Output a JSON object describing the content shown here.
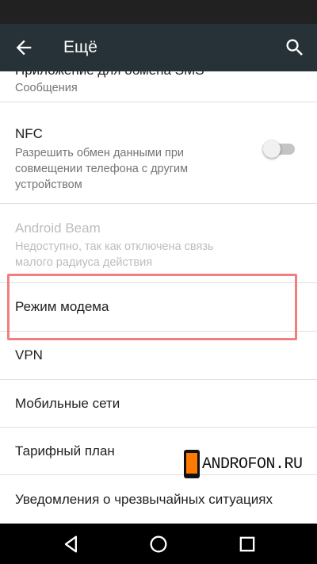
{
  "app_bar": {
    "title": "Ещё",
    "back_icon": "arrow-left-icon",
    "search_icon": "search-icon"
  },
  "items": [
    {
      "title": "Приложение для обмена SMS",
      "summary": "Сообщения"
    },
    {
      "title": "NFC",
      "summary": "Разрешить обмен данными при совмещении телефона с другим устройством",
      "toggle": "off"
    },
    {
      "title": "Android Beam",
      "summary": "Недоступно, так как отключена связь малого радиуса действия",
      "enabled": false
    },
    {
      "title": "Режим модема"
    },
    {
      "title": "VPN"
    },
    {
      "title": "Мобильные сети"
    },
    {
      "title": "Тарифный план"
    },
    {
      "title": "Уведомления о чрезвычайных ситуациях"
    }
  ],
  "watermark": {
    "text": "ANDROFON.RU"
  },
  "nav_bar": {
    "back": "triangle-back-icon",
    "home": "circle-home-icon",
    "recents": "square-recents-icon"
  },
  "colors": {
    "status_bar": "#212121",
    "app_bar": "#263238",
    "highlight": "#f08080",
    "watermark_accent": "#ff7a00"
  }
}
